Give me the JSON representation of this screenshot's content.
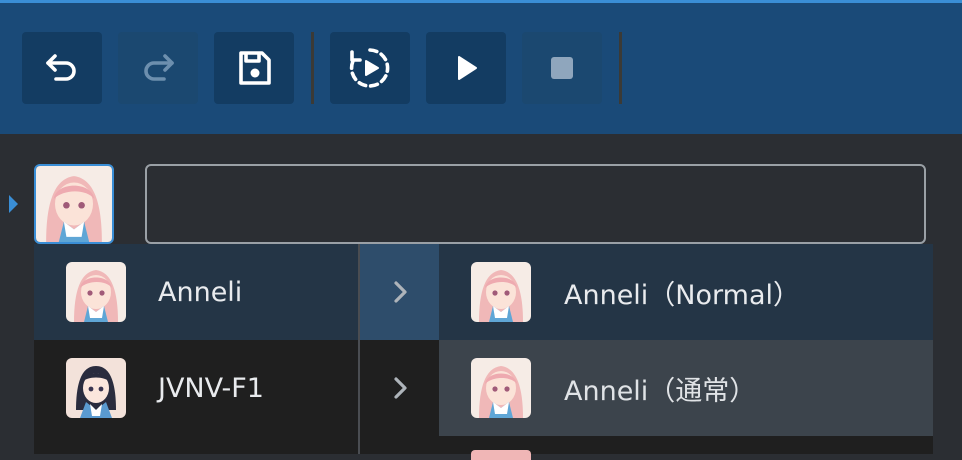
{
  "toolbar": {
    "buttons": [
      {
        "name": "undo",
        "icon": "undo-icon",
        "enabled": true
      },
      {
        "name": "redo",
        "icon": "redo-icon",
        "enabled": false
      },
      {
        "name": "save",
        "icon": "save-icon",
        "enabled": true
      },
      {
        "name": "play-continuous",
        "icon": "play-continuous-icon",
        "enabled": true
      },
      {
        "name": "play",
        "icon": "play-icon",
        "enabled": true
      },
      {
        "name": "stop",
        "icon": "stop-icon",
        "enabled": false
      }
    ]
  },
  "editor": {
    "text_value": "",
    "placeholder": ""
  },
  "character_menu": {
    "items": [
      {
        "label": "Anneli",
        "avatar": "anneli-avatar",
        "active": true
      },
      {
        "label": "JVNV-F1",
        "avatar": "jvnv-f1-avatar",
        "active": false
      }
    ]
  },
  "style_menu": {
    "items": [
      {
        "label": "Anneli（Normal）",
        "avatar": "anneli-avatar"
      },
      {
        "label": "Anneli（通常）",
        "avatar": "anneli-avatar"
      }
    ]
  },
  "colors": {
    "accent": "#3a8ed6",
    "toolbar_bg": "#1a4a78",
    "button_bg": "#133c62",
    "app_bg": "#2b2e33",
    "menu_bg": "#1f1f1f",
    "active_row": "#243546",
    "hover_row": "#3c444c"
  }
}
